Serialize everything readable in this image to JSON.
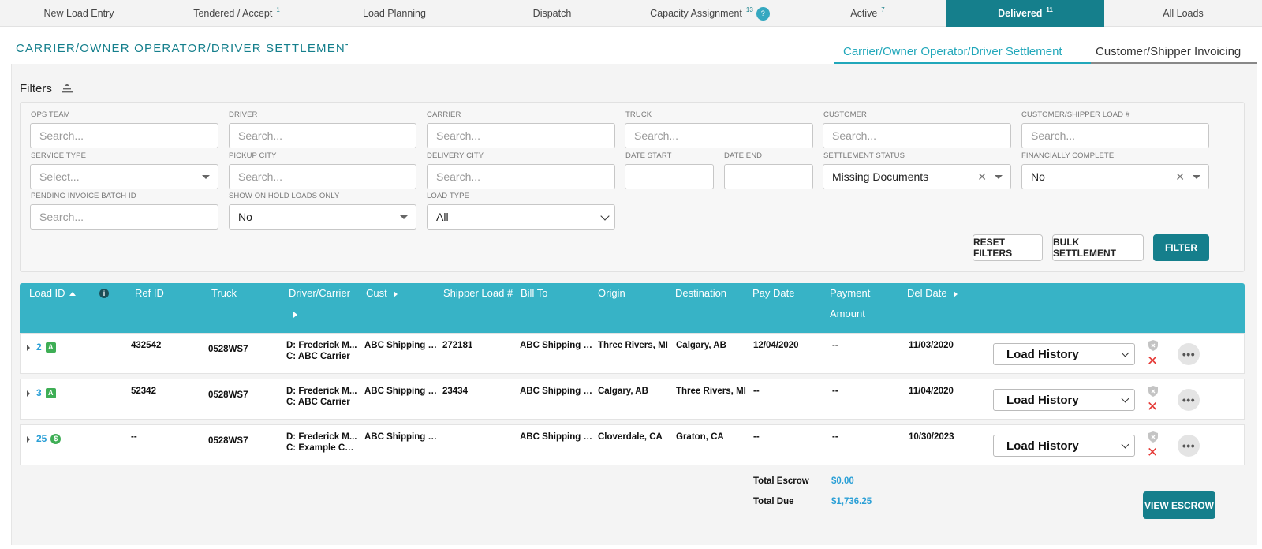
{
  "nav": {
    "tabs": [
      {
        "label": "New Load Entry",
        "count": ""
      },
      {
        "label": "Tendered / Accept",
        "count": "1"
      },
      {
        "label": "Load Planning",
        "count": ""
      },
      {
        "label": "Dispatch",
        "count": ""
      },
      {
        "label": "Capacity Assignment",
        "count": "13"
      },
      {
        "label": "Active",
        "count": "7"
      },
      {
        "label": "Delivered",
        "count": "11"
      },
      {
        "label": "All Loads",
        "count": ""
      }
    ],
    "help_glyph": "?"
  },
  "page": {
    "title": "CARRIER/OWNER OPERATOR/DRIVER SETTLEMENT",
    "subtabs": [
      "Carrier/Owner Operator/Driver Settlement",
      "Customer/Shipper Invoicing"
    ]
  },
  "filters": {
    "heading": "Filters",
    "fields": {
      "ops_team": {
        "label": "OPS TEAM",
        "placeholder": "Search..."
      },
      "driver": {
        "label": "DRIVER",
        "placeholder": "Search..."
      },
      "carrier": {
        "label": "CARRIER",
        "placeholder": "Search..."
      },
      "truck": {
        "label": "TRUCK",
        "placeholder": "Search..."
      },
      "customer": {
        "label": "CUSTOMER",
        "placeholder": "Search..."
      },
      "customer_load": {
        "label": "CUSTOMER/SHIPPER LOAD #",
        "placeholder": "Search..."
      },
      "service_type": {
        "label": "SERVICE TYPE",
        "placeholder": "Select..."
      },
      "pickup_city": {
        "label": "PICKUP CITY",
        "placeholder": "Search..."
      },
      "delivery_city": {
        "label": "DELIVERY CITY",
        "placeholder": "Search..."
      },
      "date_start": {
        "label": "DATE START",
        "value": ""
      },
      "date_end": {
        "label": "DATE END",
        "value": ""
      },
      "settlement_status": {
        "label": "SETTLEMENT STATUS",
        "value": "Missing Documents"
      },
      "financially_complete": {
        "label": "FINANCIALLY COMPLETE",
        "value": "No"
      },
      "pending_batch": {
        "label": "PENDING INVOICE BATCH ID",
        "placeholder": "Search..."
      },
      "on_hold": {
        "label": "SHOW ON HOLD LOADS ONLY",
        "value": "No"
      },
      "load_type": {
        "label": "LOAD TYPE",
        "value": "All"
      }
    },
    "buttons": {
      "reset": "RESET FILTERS",
      "bulk": "BULK SETTLEMENT",
      "filter": "FILTER"
    }
  },
  "table": {
    "headers": {
      "load_id": "Load ID",
      "ref_id": "Ref ID",
      "truck": "Truck",
      "driver_carrier": "Driver/Carrier",
      "cust": "Cust",
      "shipper_load": "Shipper Load #",
      "bill_to": "Bill To",
      "origin": "Origin",
      "destination": "Destination",
      "pay_date": "Pay Date",
      "payment_amount_1": "Payment",
      "payment_amount_2": "Amount",
      "del_date": "Del Date"
    },
    "rows": [
      {
        "load_id": "2",
        "badge": "A",
        "ref_id": "432542",
        "truck": "0528WS7",
        "driver": "D: Frederick M...",
        "carrier": "C: ABC Carrier",
        "cust": "ABC Shipping C...",
        "shipper_load": "272181",
        "bill_to": "ABC Shipping C...",
        "origin": "Three Rivers, MI",
        "destination": "Calgary, AB",
        "pay_date": "12/04/2020",
        "payment": "--",
        "del_date": "11/03/2020",
        "action": "Load History"
      },
      {
        "load_id": "3",
        "badge": "A",
        "ref_id": "52342",
        "truck": "0528WS7",
        "driver": "D: Frederick M...",
        "carrier": "C: ABC Carrier",
        "cust": "ABC Shipping C...",
        "shipper_load": "23434",
        "bill_to": "ABC Shipping C...",
        "origin": "Calgary, AB",
        "destination": "Three Rivers, MI",
        "pay_date": "--",
        "payment": "--",
        "del_date": "11/04/2020",
        "action": "Load History"
      },
      {
        "load_id": "25",
        "badge": "$",
        "ref_id": "--",
        "truck": "0528WS7",
        "driver": "D: Frederick M...",
        "carrier": "C: Example Car...",
        "cust": "ABC Shipping C...",
        "shipper_load": "",
        "bill_to": "ABC Shipping C...",
        "origin": "Cloverdale, CA",
        "destination": "Graton, CA",
        "pay_date": "--",
        "payment": "--",
        "del_date": "10/30/2023",
        "action": "Load History"
      }
    ]
  },
  "totals": {
    "escrow_label": "Total Escrow",
    "escrow_value": "$0.00",
    "due_label": "Total Due",
    "due_value": "$1,736.25",
    "view_escrow": "VIEW ESCROW"
  },
  "colors": {
    "primary": "#157f8c",
    "header": "#37b3c6",
    "link": "#2a9fd6",
    "danger": "#e53935",
    "badge": "#3eae55"
  }
}
